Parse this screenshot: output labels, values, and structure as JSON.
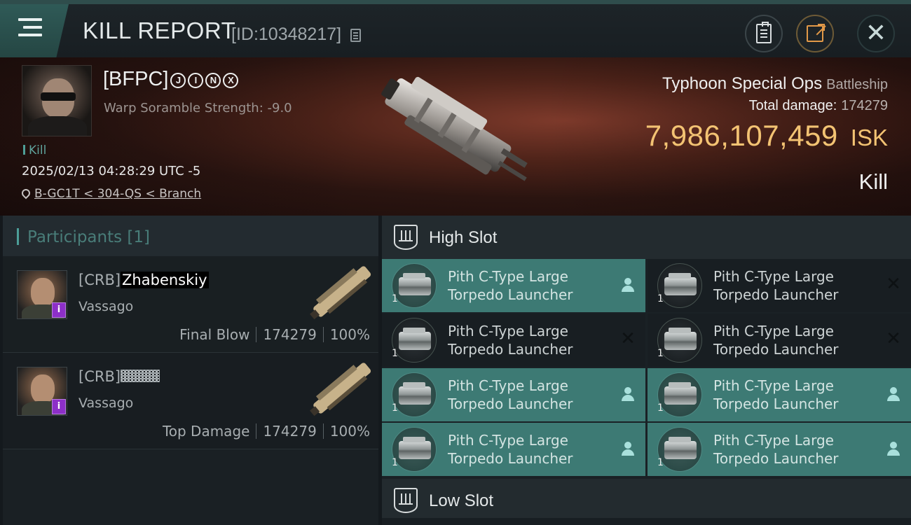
{
  "header": {
    "title": "KILL REPORT",
    "report_id": "[ID:10348217]"
  },
  "victim": {
    "name_prefix": "[BFPC]",
    "name_tags": [
      "J",
      "I",
      "N",
      "X"
    ],
    "scramble": "Warp Soramble Strength: -9.0",
    "kill_tag": "Kill",
    "timestamp": "2025/02/13 04:28:29 UTC -5",
    "location": "B-GC1T < 304-QS < Branch",
    "ship_name": "Typhoon Special Ops",
    "ship_class": "Battleship",
    "total_damage_label": "Total damage:",
    "total_damage_value": "174279",
    "isk_value": "7,986,107,459",
    "isk_unit": "ISK",
    "result": "Kill"
  },
  "participants": {
    "header": "Participants [1]",
    "items": [
      {
        "corp": "[CRB]",
        "name": "Zhabenskiy",
        "ship": "Vassago",
        "role": "Final Blow",
        "damage": "174279",
        "percent": "100%",
        "badge": "i"
      },
      {
        "corp": "[CRB]",
        "name": "",
        "ship": "Vassago",
        "role": "Top Damage",
        "damage": "174279",
        "percent": "100%",
        "badge": "i"
      }
    ]
  },
  "slots": {
    "high_title": "High Slot",
    "low_title": "Low Slot",
    "high_items": [
      {
        "line1": "Pith C-Type Large",
        "line2": "Torpedo Launcher",
        "qty": "1",
        "status": "dropped",
        "status_icon": "person-icon"
      },
      {
        "line1": "Pith C-Type Large",
        "line2": "Torpedo Launcher",
        "qty": "1",
        "status": "destroyed",
        "status_icon": "x-icon"
      },
      {
        "line1": "Pith C-Type Large",
        "line2": "Torpedo Launcher",
        "qty": "1",
        "status": "destroyed",
        "status_icon": "x-icon"
      },
      {
        "line1": "Pith C-Type Large",
        "line2": "Torpedo Launcher",
        "qty": "1",
        "status": "destroyed",
        "status_icon": "x-icon"
      },
      {
        "line1": "Pith C-Type Large",
        "line2": "Torpedo Launcher",
        "qty": "1",
        "status": "dropped",
        "status_icon": "person-icon"
      },
      {
        "line1": "Pith C-Type Large",
        "line2": "Torpedo Launcher",
        "qty": "1",
        "status": "dropped",
        "status_icon": "person-icon"
      },
      {
        "line1": "Pith C-Type Large",
        "line2": "Torpedo Launcher",
        "qty": "1",
        "status": "dropped",
        "status_icon": "person-icon"
      },
      {
        "line1": "Pith C-Type Large",
        "line2": "Torpedo Launcher",
        "qty": "1",
        "status": "dropped",
        "status_icon": "person-icon"
      }
    ]
  },
  "colors": {
    "accent": "#3d7a74",
    "isk": "#f3c373",
    "badge": "#8d2fc8"
  }
}
